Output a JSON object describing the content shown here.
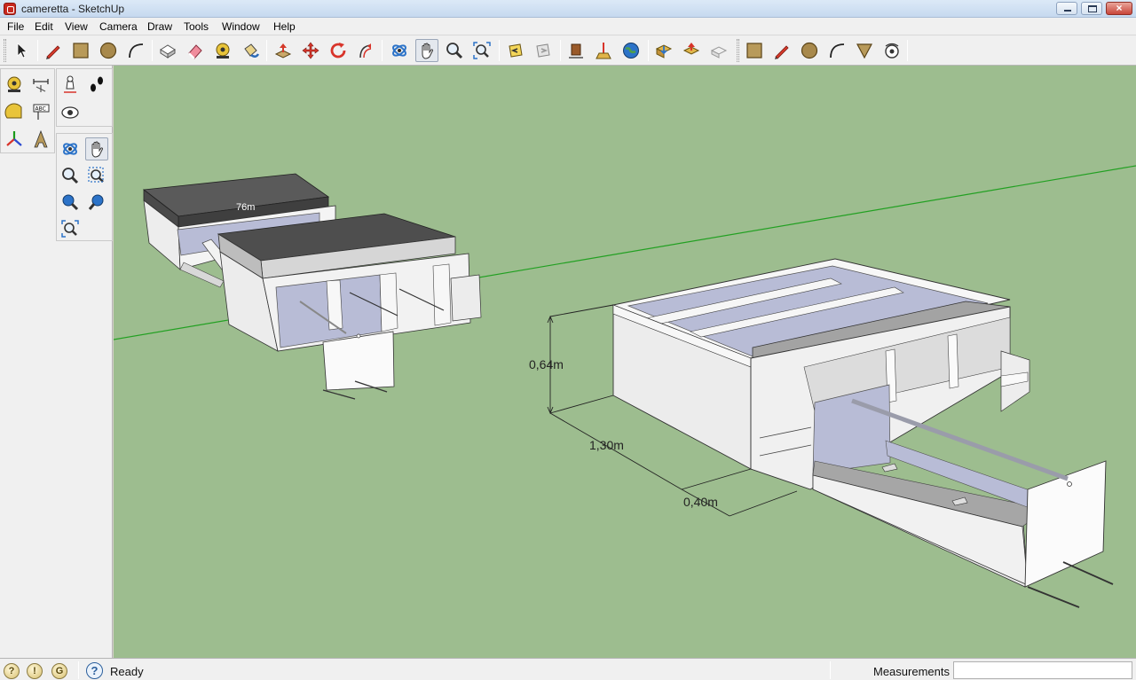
{
  "window": {
    "title": "cameretta - SketchUp",
    "minimize_glyph": "",
    "maximize_glyph": "",
    "close_glyph": "×"
  },
  "menu": [
    {
      "id": "file",
      "label": "File"
    },
    {
      "id": "edit",
      "label": "Edit"
    },
    {
      "id": "view",
      "label": "View"
    },
    {
      "id": "camera",
      "label": "Camera"
    },
    {
      "id": "draw",
      "label": "Draw"
    },
    {
      "id": "tools",
      "label": "Tools"
    },
    {
      "id": "window",
      "label": "Window"
    },
    {
      "id": "help",
      "label": "Help"
    }
  ],
  "toolbar": {
    "tools": [
      {
        "name": "select-icon",
        "group": 1
      },
      {
        "name": "pencil-line-icon",
        "group": 1
      },
      {
        "name": "rectangle-icon",
        "group": 1
      },
      {
        "name": "circle-icon",
        "group": 1
      },
      {
        "name": "arc-icon",
        "group": 1
      },
      {
        "name": "make-component-icon",
        "group": 2
      },
      {
        "name": "eraser-icon",
        "group": 2
      },
      {
        "name": "tape-measure-icon",
        "group": 2
      },
      {
        "name": "paint-bucket-icon",
        "group": 2
      },
      {
        "name": "push-pull-icon",
        "group": 3
      },
      {
        "name": "move-icon",
        "group": 3
      },
      {
        "name": "rotate-icon",
        "group": 3
      },
      {
        "name": "offset-icon",
        "group": 3
      },
      {
        "name": "orbit-icon",
        "group": 4
      },
      {
        "name": "pan-icon",
        "group": 4,
        "active": true
      },
      {
        "name": "zoom-icon",
        "group": 4
      },
      {
        "name": "zoom-extents-icon",
        "group": 4
      },
      {
        "name": "previous-view-icon",
        "group": 5
      },
      {
        "name": "next-view-icon",
        "group": 5
      },
      {
        "name": "get-models-icon",
        "group": 6
      },
      {
        "name": "add-location-icon",
        "group": 6
      },
      {
        "name": "google-earth-icon",
        "group": 6
      },
      {
        "name": "get-models-warehouse-icon",
        "group": 7
      },
      {
        "name": "share-model-icon",
        "group": 7
      },
      {
        "name": "share-component-icon",
        "group": 7
      },
      {
        "name": "rectangle-icon-2",
        "group": 8
      },
      {
        "name": "pencil-line-icon-2",
        "group": 8
      },
      {
        "name": "circle-icon-2",
        "group": 8
      },
      {
        "name": "arc-icon-2",
        "group": 8
      },
      {
        "name": "sandbox-from-contours-icon",
        "group": 8
      },
      {
        "name": "look-around-icon",
        "group": 8
      }
    ]
  },
  "left_palettes": {
    "construction": [
      "tape-measure-icon",
      "dimension-icon",
      "protractor-icon",
      "text-icon",
      "axes-icon",
      "3d-text-icon"
    ],
    "walkthrough": [
      "position-camera-icon",
      "walk-icon",
      "look-around-icon"
    ],
    "camera": [
      "orbit-icon",
      "pan-icon",
      "zoom-icon",
      "zoom-window-icon",
      "previous-view-icon",
      "next-view-icon",
      "zoom-extents-icon"
    ]
  },
  "scene": {
    "dimensions": {
      "height": "0,64m",
      "length": "1,30m",
      "depth": "0,40m"
    },
    "back_model_label": "76m"
  },
  "status": {
    "icons": [
      "geo-location-icon",
      "credits-icon",
      "user-icon"
    ],
    "help_glyph": "?",
    "text": "Ready",
    "measurements_label": "Measurements",
    "measurements_value": ""
  },
  "colors": {
    "sky_ground": "#9dbd8f",
    "green_axis": "#22a022",
    "mattress": "#4a4a4a",
    "panel_white": "#f4f4f4",
    "panel_blue": "#b8bcd6",
    "panel_grey": "#a0a0a0"
  }
}
